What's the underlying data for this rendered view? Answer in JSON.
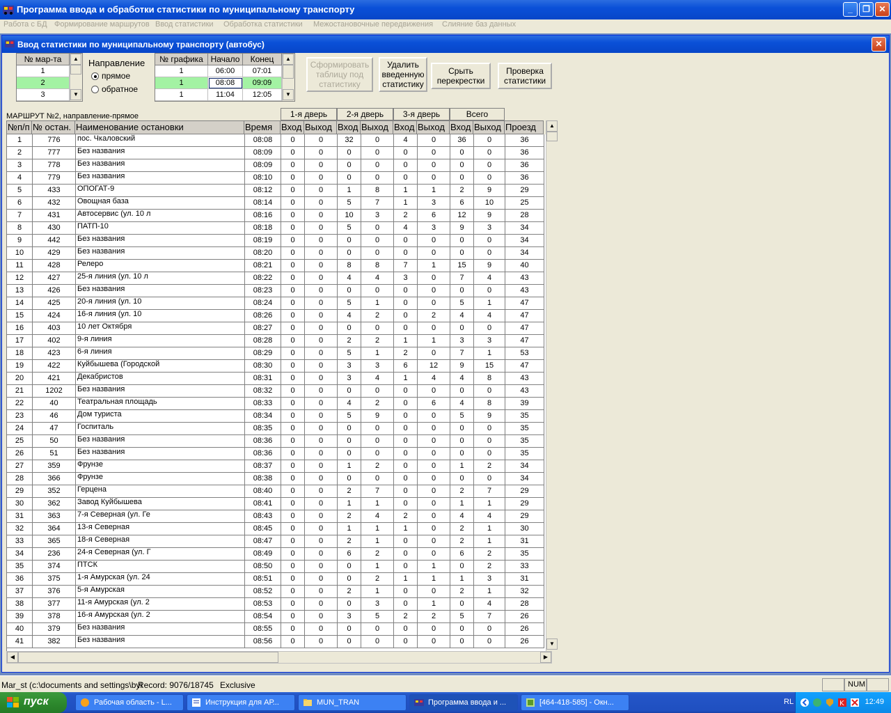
{
  "window": {
    "title": "Программа ввода и обработки статистики по муниципальному транспорту",
    "controls": {
      "minimize": "_",
      "restore": "❐",
      "close": "✕"
    }
  },
  "menu": [
    "Работа с БД",
    "Формирование маршрутов",
    "Ввод статистики",
    "Обработка статистики",
    "Межостановочные передвижения",
    "Слияние баз данных"
  ],
  "child": {
    "title": "Ввод статистики по муниципальному транспорту (автобус)",
    "close": "✕"
  },
  "routes_grid": {
    "header": "№ мар-та",
    "rows": [
      "1",
      "2",
      "3"
    ],
    "selected_index": 1
  },
  "direction": {
    "label": "Направление",
    "options": [
      "прямое",
      "обратное"
    ],
    "selected": "прямое"
  },
  "schedule_grid": {
    "headers": [
      "№ графика",
      "Начало",
      "Конец"
    ],
    "rows": [
      [
        "1",
        "06:00",
        "07:01"
      ],
      [
        "1",
        "08:08",
        "09:09"
      ],
      [
        "1",
        "11:04",
        "12:05"
      ]
    ],
    "selected_index": 1
  },
  "buttons": {
    "form_table": "Сформировать таблицу под статистику",
    "delete_stats": "Удалить введенную статистику",
    "hide_crossings": "Срыть перекрестки",
    "check_stats": "Проверка статистики"
  },
  "route_caption": "МАРШРУТ №2, направление-прямое",
  "stats_table": {
    "group_headers": [
      "1-я дверь",
      "2-я дверь",
      "3-я дверь",
      "Всего"
    ],
    "headers": [
      "№п/п",
      "№ остан.",
      "Наименование остановки",
      "Время",
      "Вход",
      "Выход",
      "Вход",
      "Выход",
      "Вход",
      "Выход",
      "Вход",
      "Выход",
      "Проезд"
    ],
    "rows": [
      [
        "1",
        "776",
        "пос. Чкаловский",
        "08:08",
        "0",
        "0",
        "32",
        "0",
        "4",
        "0",
        "36",
        "0",
        "36"
      ],
      [
        "2",
        "777",
        "Без названия",
        "08:09",
        "0",
        "0",
        "0",
        "0",
        "0",
        "0",
        "0",
        "0",
        "36"
      ],
      [
        "3",
        "778",
        "Без названия",
        "08:09",
        "0",
        "0",
        "0",
        "0",
        "0",
        "0",
        "0",
        "0",
        "36"
      ],
      [
        "4",
        "779",
        "Без названия",
        "08:10",
        "0",
        "0",
        "0",
        "0",
        "0",
        "0",
        "0",
        "0",
        "36"
      ],
      [
        "5",
        "433",
        "ОПОГАТ-9",
        "08:12",
        "0",
        "0",
        "1",
        "8",
        "1",
        "1",
        "2",
        "9",
        "29"
      ],
      [
        "6",
        "432",
        "Овощная база",
        "08:14",
        "0",
        "0",
        "5",
        "7",
        "1",
        "3",
        "6",
        "10",
        "25"
      ],
      [
        "7",
        "431",
        "Автосервис (ул. 10 л",
        "08:16",
        "0",
        "0",
        "10",
        "3",
        "2",
        "6",
        "12",
        "9",
        "28"
      ],
      [
        "8",
        "430",
        "ПАТП-10",
        "08:18",
        "0",
        "0",
        "5",
        "0",
        "4",
        "3",
        "9",
        "3",
        "34"
      ],
      [
        "9",
        "442",
        "Без названия",
        "08:19",
        "0",
        "0",
        "0",
        "0",
        "0",
        "0",
        "0",
        "0",
        "34"
      ],
      [
        "10",
        "429",
        "Без названия",
        "08:20",
        "0",
        "0",
        "0",
        "0",
        "0",
        "0",
        "0",
        "0",
        "34"
      ],
      [
        "11",
        "428",
        "Релеро",
        "08:21",
        "0",
        "0",
        "8",
        "8",
        "7",
        "1",
        "15",
        "9",
        "40"
      ],
      [
        "12",
        "427",
        "25-я линия (ул. 10 л",
        "08:22",
        "0",
        "0",
        "4",
        "4",
        "3",
        "0",
        "7",
        "4",
        "43"
      ],
      [
        "13",
        "426",
        "Без названия",
        "08:23",
        "0",
        "0",
        "0",
        "0",
        "0",
        "0",
        "0",
        "0",
        "43"
      ],
      [
        "14",
        "425",
        "20-я линия  (ул. 10",
        "08:24",
        "0",
        "0",
        "5",
        "1",
        "0",
        "0",
        "5",
        "1",
        "47"
      ],
      [
        "15",
        "424",
        "16-я линия  (ул. 10",
        "08:26",
        "0",
        "0",
        "4",
        "2",
        "0",
        "2",
        "4",
        "4",
        "47"
      ],
      [
        "16",
        "403",
        "10 лет Октября",
        "08:27",
        "0",
        "0",
        "0",
        "0",
        "0",
        "0",
        "0",
        "0",
        "47"
      ],
      [
        "17",
        "402",
        "9-я линия",
        "08:28",
        "0",
        "0",
        "2",
        "2",
        "1",
        "1",
        "3",
        "3",
        "47"
      ],
      [
        "18",
        "423",
        "6-я линия",
        "08:29",
        "0",
        "0",
        "5",
        "1",
        "2",
        "0",
        "7",
        "1",
        "53"
      ],
      [
        "19",
        "422",
        "Куйбышева (Городской",
        "08:30",
        "0",
        "0",
        "3",
        "3",
        "6",
        "12",
        "9",
        "15",
        "47"
      ],
      [
        "20",
        "421",
        "Декабристов",
        "08:31",
        "0",
        "0",
        "3",
        "4",
        "1",
        "4",
        "4",
        "8",
        "43"
      ],
      [
        "21",
        "1202",
        "Без названия",
        "08:32",
        "0",
        "0",
        "0",
        "0",
        "0",
        "0",
        "0",
        "0",
        "43"
      ],
      [
        "22",
        "40",
        "Театральная площадь",
        "08:33",
        "0",
        "0",
        "4",
        "2",
        "0",
        "6",
        "4",
        "8",
        "39"
      ],
      [
        "23",
        "46",
        "Дом туриста",
        "08:34",
        "0",
        "0",
        "5",
        "9",
        "0",
        "0",
        "5",
        "9",
        "35"
      ],
      [
        "24",
        "47",
        "Госпиталь",
        "08:35",
        "0",
        "0",
        "0",
        "0",
        "0",
        "0",
        "0",
        "0",
        "35"
      ],
      [
        "25",
        "50",
        "Без названия",
        "08:36",
        "0",
        "0",
        "0",
        "0",
        "0",
        "0",
        "0",
        "0",
        "35"
      ],
      [
        "26",
        "51",
        "Без названия",
        "08:36",
        "0",
        "0",
        "0",
        "0",
        "0",
        "0",
        "0",
        "0",
        "35"
      ],
      [
        "27",
        "359",
        "Фрунзе",
        "08:37",
        "0",
        "0",
        "1",
        "2",
        "0",
        "0",
        "1",
        "2",
        "34"
      ],
      [
        "28",
        "366",
        "Фрунзе",
        "08:38",
        "0",
        "0",
        "0",
        "0",
        "0",
        "0",
        "0",
        "0",
        "34"
      ],
      [
        "29",
        "352",
        "Герцена",
        "08:40",
        "0",
        "0",
        "2",
        "7",
        "0",
        "0",
        "2",
        "7",
        "29"
      ],
      [
        "30",
        "362",
        "Завод Куйбышева",
        "08:41",
        "0",
        "0",
        "1",
        "1",
        "0",
        "0",
        "1",
        "1",
        "29"
      ],
      [
        "31",
        "363",
        "7-я Северная (ул. Ге",
        "08:43",
        "0",
        "0",
        "2",
        "4",
        "2",
        "0",
        "4",
        "4",
        "29"
      ],
      [
        "32",
        "364",
        "13-я Северная",
        "08:45",
        "0",
        "0",
        "1",
        "1",
        "1",
        "0",
        "2",
        "1",
        "30"
      ],
      [
        "33",
        "365",
        "18-я Северная",
        "08:47",
        "0",
        "0",
        "2",
        "1",
        "0",
        "0",
        "2",
        "1",
        "31"
      ],
      [
        "34",
        "236",
        "24-я Северная (ул. Г",
        "08:49",
        "0",
        "0",
        "6",
        "2",
        "0",
        "0",
        "6",
        "2",
        "35"
      ],
      [
        "35",
        "374",
        "ПТСК",
        "08:50",
        "0",
        "0",
        "0",
        "1",
        "0",
        "1",
        "0",
        "2",
        "33"
      ],
      [
        "36",
        "375",
        "1-я Амурская (ул. 24",
        "08:51",
        "0",
        "0",
        "0",
        "2",
        "1",
        "1",
        "1",
        "3",
        "31"
      ],
      [
        "37",
        "376",
        "5-я Амурская",
        "08:52",
        "0",
        "0",
        "2",
        "1",
        "0",
        "0",
        "2",
        "1",
        "32"
      ],
      [
        "38",
        "377",
        "11-я Амурская (ул. 2",
        "08:53",
        "0",
        "0",
        "0",
        "3",
        "0",
        "1",
        "0",
        "4",
        "28"
      ],
      [
        "39",
        "378",
        "16-я Амурская (ул. 2",
        "08:54",
        "0",
        "0",
        "3",
        "5",
        "2",
        "2",
        "5",
        "7",
        "26"
      ],
      [
        "40",
        "379",
        "Без названия",
        "08:55",
        "0",
        "0",
        "0",
        "0",
        "0",
        "0",
        "0",
        "0",
        "26"
      ],
      [
        "41",
        "382",
        "Без названия",
        "08:56",
        "0",
        "0",
        "0",
        "0",
        "0",
        "0",
        "0",
        "0",
        "26"
      ]
    ]
  },
  "status": {
    "path": "Mar_st (c:\\documents and settings\\byl",
    "record": "Record: 9076/18745",
    "mode": "Exclusive",
    "num": "NUM"
  },
  "taskbar": {
    "start": "пуск",
    "tasks": [
      "Рабочая область - L...",
      "Инструкция для АР...",
      "MUN_TRAN",
      "Программа ввода и ...",
      "[464-418-585] - Окн..."
    ],
    "active_task": 3,
    "lang": "RL",
    "clock": "12:49"
  },
  "colors": {
    "title_blue": "#0a50d8",
    "selection_green": "#a3f2a3",
    "mdi_bg": "#6d8bc1"
  }
}
